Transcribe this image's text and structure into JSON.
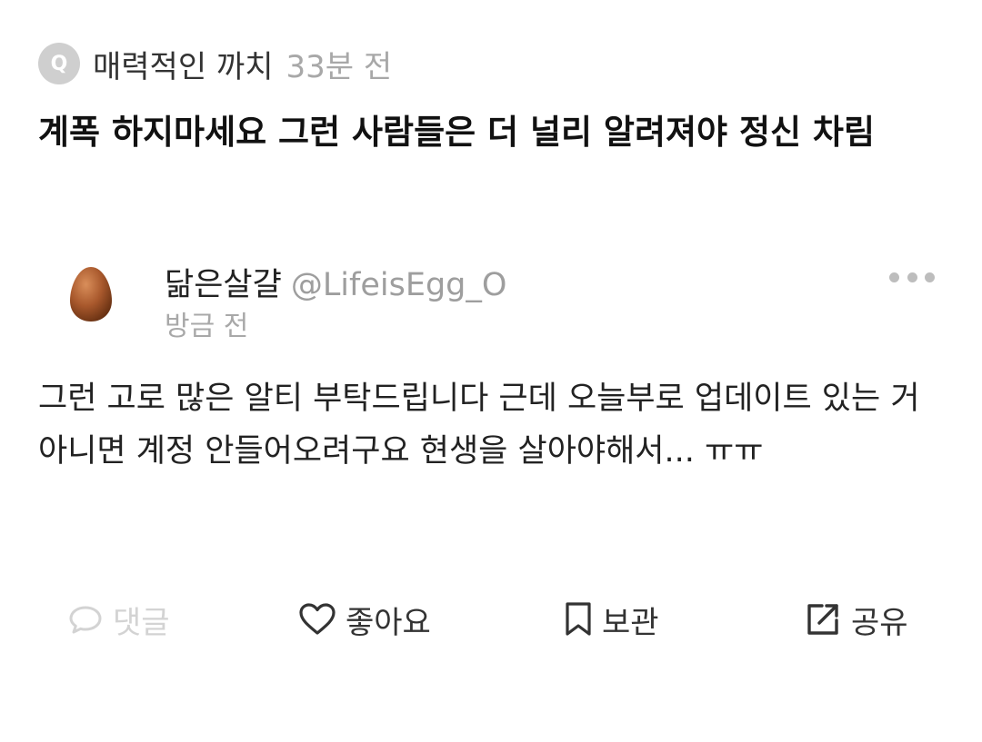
{
  "question": {
    "badge": "Q",
    "author": "매력적인 까치",
    "time": "33분 전",
    "text": "계폭 하지마세요 그런 사람들은 더 널리 알려져야 정신 차림"
  },
  "answer": {
    "avatar_icon": "egg-avatar",
    "display_name": "닮은살걀",
    "handle": "@LifeisEgg_O",
    "time": "방금 전",
    "text": "그런 고로 많은 알티 부탁드립니다 근데 오늘부로 업데이트 있는 거 아니면 계정 안들어오려구요 현생을 살아야해서... ㅠㅠ"
  },
  "actions": {
    "comment": {
      "label": "댓글",
      "icon": "comment-icon",
      "color": "#d3d3d3"
    },
    "like": {
      "label": "좋아요",
      "icon": "heart-icon"
    },
    "bookmark": {
      "label": "보관",
      "icon": "bookmark-icon"
    },
    "share": {
      "label": "공유",
      "icon": "share-icon"
    }
  }
}
